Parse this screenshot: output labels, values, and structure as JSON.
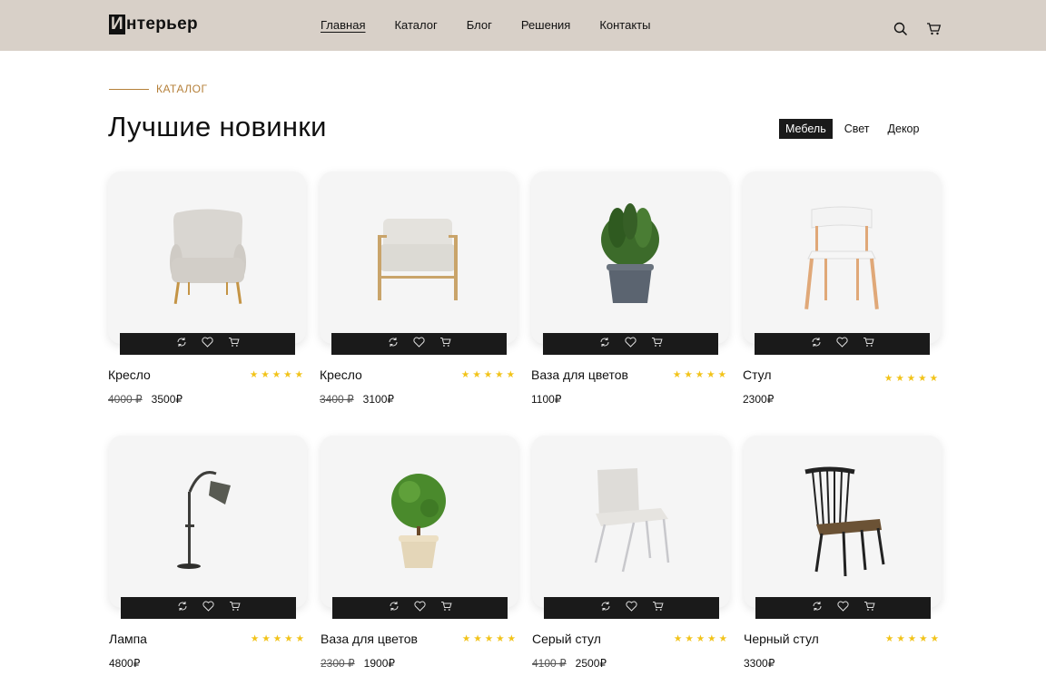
{
  "brand": {
    "first": "И",
    "rest": "нтерьер"
  },
  "nav": [
    {
      "label": "Главная",
      "active": true
    },
    {
      "label": "Каталог"
    },
    {
      "label": "Блог"
    },
    {
      "label": "Решения"
    },
    {
      "label": "Контакты"
    }
  ],
  "header_icons": [
    "search-icon",
    "cart-icon"
  ],
  "section": {
    "label": "КАТАЛОГ",
    "title": "Лучшие новинки"
  },
  "filters": [
    {
      "label": "Мебель",
      "active": true
    },
    {
      "label": "Свет"
    },
    {
      "label": "Декор"
    }
  ],
  "rating_stars": "★★★★★",
  "products": [
    {
      "name": "Кресло",
      "old_price": "4000 ₽",
      "price": "3500₽",
      "icon": "armchair-icon"
    },
    {
      "name": "Кресло",
      "old_price": "3400 ₽",
      "price": "3100₽",
      "icon": "wooden-armchair-icon"
    },
    {
      "name": "Ваза для цветов",
      "old_price": "",
      "price": "1100₽",
      "icon": "potted-plant-icon"
    },
    {
      "name": "Стул",
      "old_price": "",
      "price": "2300₽",
      "icon": "wooden-chair-icon"
    },
    {
      "name": "Лампа",
      "old_price": "",
      "price": "4800₽",
      "icon": "floor-lamp-icon"
    },
    {
      "name": "Ваза для цветов",
      "old_price": "2300 ₽",
      "price": "1900₽",
      "icon": "topiary-plant-icon"
    },
    {
      "name": "Серый стул",
      "old_price": "4100 ₽",
      "price": "2500₽",
      "icon": "grey-chair-icon"
    },
    {
      "name": "Черный стул",
      "old_price": "",
      "price": "3300₽",
      "icon": "black-windsor-chair-icon"
    }
  ],
  "card_actions": [
    "compare-icon",
    "heart-icon",
    "cart-icon"
  ],
  "colors": {
    "header_bg": "#d8d0c8",
    "accent": "#b5803a",
    "stars": "#f2c318",
    "dark": "#1a1a1a"
  }
}
